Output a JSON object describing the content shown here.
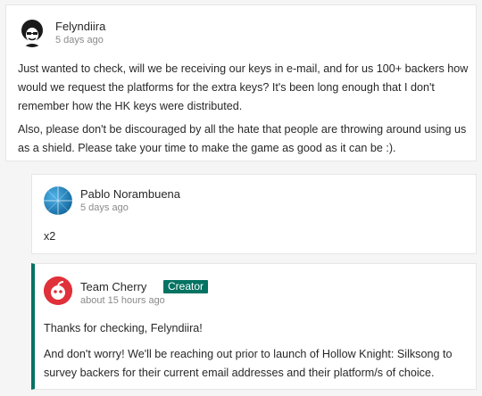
{
  "comments": [
    {
      "author": "Felyndiira",
      "time": "5 days ago",
      "avatar_icon": "afro-silhouette-icon",
      "paragraphs": [
        "Just wanted to check, will we be receiving our keys in e-mail, and for us 100+ backers how would we request the platforms for the extra keys? It's been long enough that I don't remember how the HK keys were distributed.",
        "Also, please don't be discouraged by all the hate that people are throwing around using us as a shield. Please take your time to make the game as good as it can be :)."
      ]
    },
    {
      "author": "Pablo Norambuena",
      "time": "5 days ago",
      "avatar_icon": "blue-sphere-avatar-icon",
      "paragraphs": [
        "x2"
      ]
    },
    {
      "author": "Team Cherry",
      "badge": "Creator",
      "time": "about 15 hours ago",
      "avatar_icon": "cherry-logo-icon",
      "paragraphs": [
        "Thanks for checking, Felyndiira!",
        "And don't worry! We'll be reaching out prior to launch of Hollow Knight: Silksong to survey backers for their current email addresses and their platform/s of choice."
      ]
    }
  ],
  "colors": {
    "creator_accent": "#037362",
    "cherry_red": "#e0303a",
    "avatar_blue": "#1c86c9"
  }
}
